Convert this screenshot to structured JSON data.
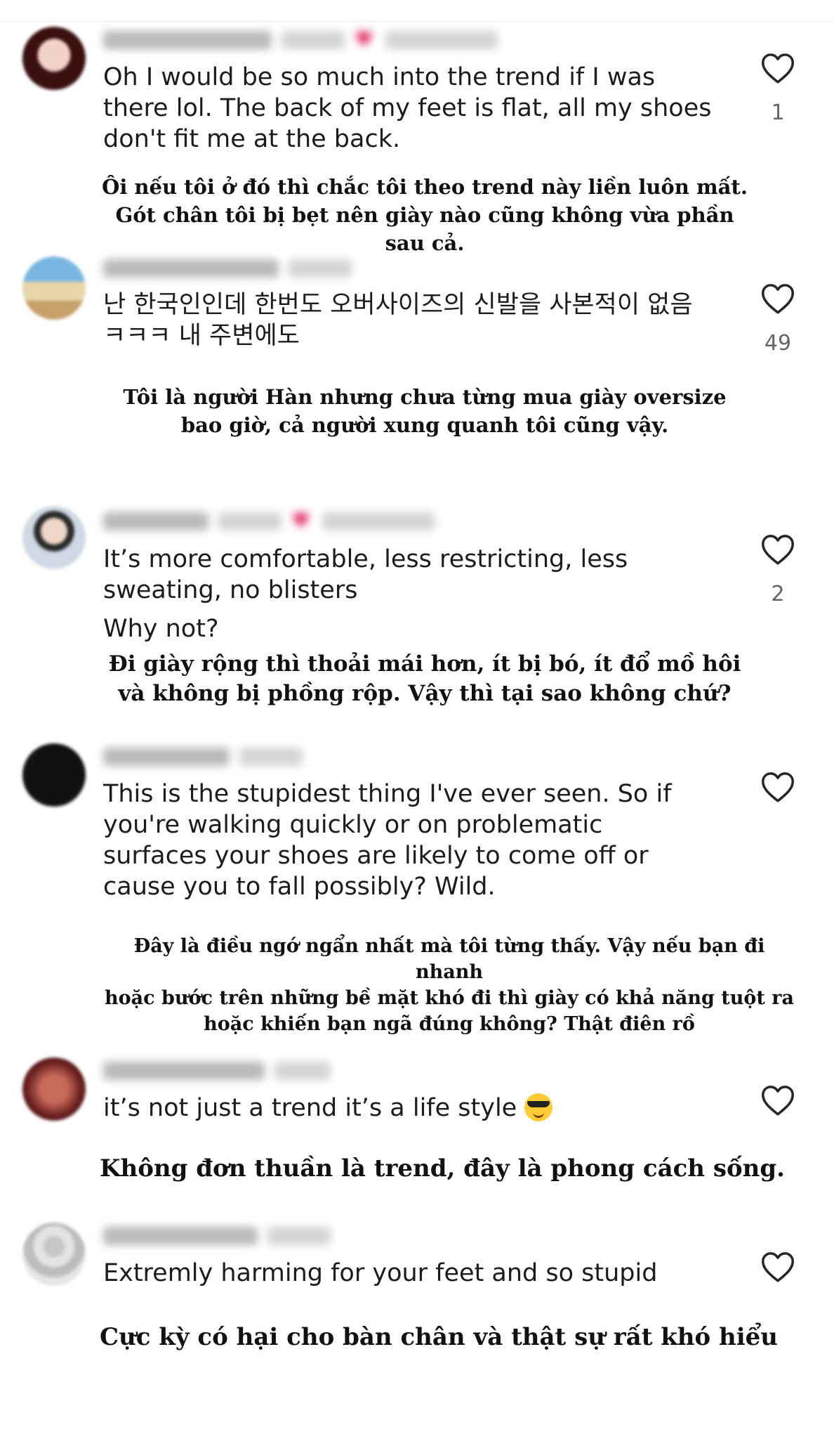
{
  "comments": [
    {
      "text": "Oh I would be so much into the trend if I was\nthere lol. The back of my feet is flat, all my shoes\ndon't fit me at the back.",
      "likes": "1",
      "translation": "Ôi nếu tôi ở đó thì chắc tôi theo trend này liền luôn mất.\nGót chân tôi bị bẹt nên giày nào cũng không vừa phần\nsau cả."
    },
    {
      "text": "난 한국인인데 한번도 오버사이즈의 신발을 사본적이 없음\nㅋㅋㅋ 내 주변에도",
      "likes": "49",
      "translation": "Tôi là người Hàn nhưng chưa từng mua giày oversize\nbao giờ, cả người xung quanh tôi cũng vậy."
    },
    {
      "text": "It’s more comfortable, less restricting, less\nsweating, no blisters",
      "text2": "Why not?",
      "likes": "2",
      "translation": "Đi giày rộng thì thoải mái hơn, ít bị bó, ít đổ mồ hôi\nvà không bị phồng rộp. Vậy thì tại sao không chứ?"
    },
    {
      "text": "This is the stupidest thing I've ever seen. So if\nyou're walking quickly or on problematic\nsurfaces your shoes are likely to come off or\ncause you to fall possibly? Wild.",
      "translation": "Đây là điều ngớ ngẩn nhất mà tôi từng thấy. Vậy nếu bạn đi nhanh\nhoặc bước trên những bề mặt khó đi thì giày có khả năng tuột ra\nhoặc khiến bạn ngã đúng không? Thật điên rồ"
    },
    {
      "text": "it’s not just a trend it’s a life style",
      "emoji": "smiling-face-with-sunglasses",
      "translation": "Không đơn thuần là trend, đây là phong cách sống."
    },
    {
      "text": "Extremly harming for your feet and so stupid",
      "translation": "Cực kỳ có hại cho bàn chân và thật sự rất khó hiểu"
    }
  ],
  "colors": {
    "text": "#1c1c1c",
    "translation": "#111111",
    "count": "#666666",
    "author_heart": "#e0245e"
  }
}
